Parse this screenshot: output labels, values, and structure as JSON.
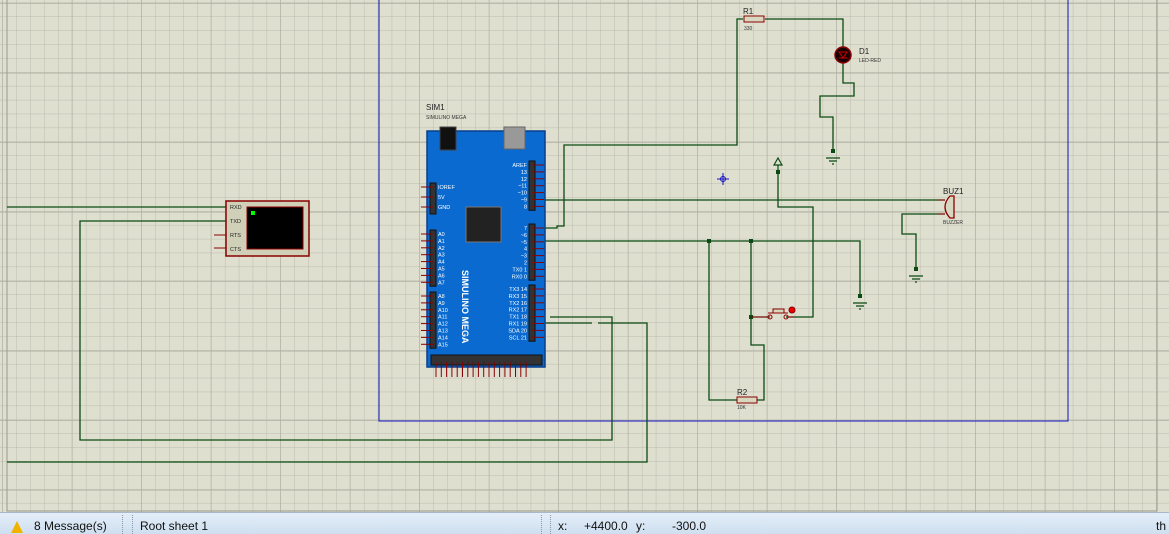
{
  "status_bar": {
    "messages": "8 Message(s)",
    "sheet": "Root sheet 1",
    "x_label": "x:",
    "x_value": "+4400.0",
    "y_label": "y:",
    "y_value": "-300.0",
    "trailing": "th"
  },
  "components": {
    "sim1": {
      "ref": "SIM1",
      "value": "SIMULINO MEGA"
    },
    "r1": {
      "ref": "R1",
      "value": "330"
    },
    "d1": {
      "ref": "D1",
      "value": "LED-RED"
    },
    "buz1": {
      "ref": "BUZ1",
      "value": "BUZZER"
    },
    "r2": {
      "ref": "R2",
      "value": "10K"
    },
    "terminal": {
      "pins": [
        "RXD",
        "TXD",
        "RTS",
        "CTS"
      ]
    }
  },
  "board": {
    "left_power": [
      "IOREF",
      "5V",
      "GND"
    ],
    "left_analog": [
      "A0",
      "A1",
      "A2",
      "A3",
      "A4",
      "A5",
      "A6",
      "A7"
    ],
    "left_analog2": [
      "A8",
      "A9",
      "A10",
      "A11",
      "A12",
      "A13",
      "A14",
      "A15"
    ],
    "right_top": [
      "AREF",
      "13",
      "12",
      "~11",
      "~10",
      "~9",
      "8"
    ],
    "right_mid": [
      "7",
      "~6",
      "~5",
      "4",
      "~3",
      "2",
      "TX0 1",
      "RX0 0"
    ],
    "right_bot": [
      "TX3 14",
      "RX3 15",
      "TX2 16",
      "RX2 17",
      "TX1 18",
      "RX1 19",
      "SDA 20",
      "SCL 21"
    ],
    "brand": "SIMULINO MEGA"
  },
  "colors": {
    "wire": "#0b4a12",
    "component": "#8b0000",
    "frame": "#1010c0",
    "board": "#0a6ad0"
  }
}
